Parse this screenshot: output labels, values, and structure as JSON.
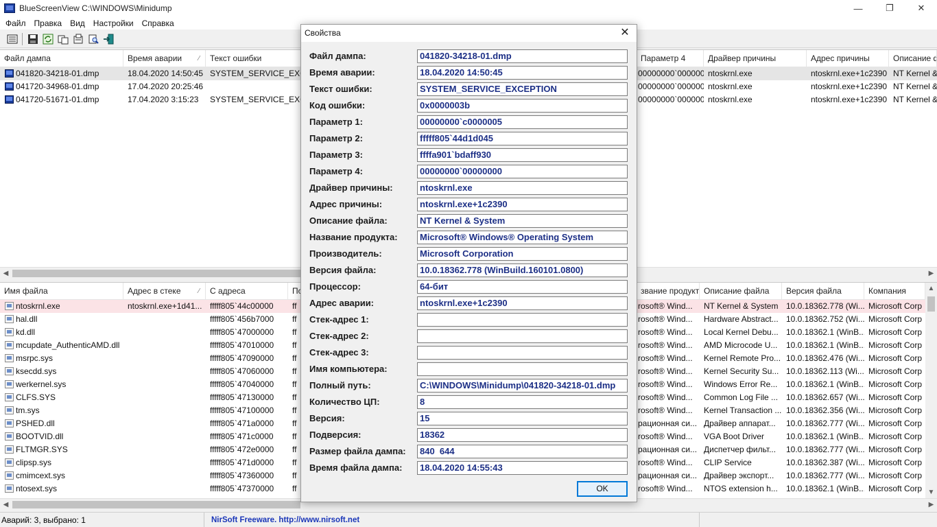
{
  "window": {
    "title": "BlueScreenView    C:\\WINDOWS\\Minidump",
    "minimize": "—",
    "restore": "❐",
    "close": "✕"
  },
  "menu": [
    "Файл",
    "Правка",
    "Вид",
    "Настройки",
    "Справка"
  ],
  "toolbar": {
    "icons": [
      "properties-icon",
      "save-icon",
      "refresh-icon",
      "copy-icon",
      "options-icon",
      "find-icon",
      "exit-icon"
    ]
  },
  "top_list": {
    "columns": [
      "Файл дампа",
      "Время аварии",
      "Текст ошибки",
      "Параметр 4",
      "Драйвер причины",
      "Адрес причины",
      "Описание ф"
    ],
    "sort_indicator": "⁄",
    "rows": [
      {
        "file": "041820-34218-01.dmp",
        "time": "18.04.2020 14:50:45",
        "text": "SYSTEM_SERVICE_EXCEPT",
        "p4": "00000000`000000...",
        "driver": "ntoskrnl.exe",
        "address": "ntoskrnl.exe+1c2390",
        "desc": "NT Kernel & S"
      },
      {
        "file": "041720-34968-01.dmp",
        "time": "17.04.2020 20:25:46",
        "text": "",
        "p4": "00000000`000000...",
        "driver": "ntoskrnl.exe",
        "address": "ntoskrnl.exe+1c2390",
        "desc": "NT Kernel & S"
      },
      {
        "file": "041720-51671-01.dmp",
        "time": "17.04.2020 3:15:23",
        "text": "SYSTEM_SERVICE_EXCEPT",
        "p4": "00000000`000000...",
        "driver": "ntoskrnl.exe",
        "address": "ntoskrnl.exe+1c2390",
        "desc": "NT Kernel & S"
      }
    ]
  },
  "bottom_list": {
    "columns": [
      "Имя файла",
      "Адрес в стеке",
      "С адреса",
      "По",
      "звание продукта",
      "Описание файла",
      "Версия файла",
      "Компания"
    ],
    "sort_indicator": "⁄",
    "rows": [
      {
        "name": "ntoskrnl.exe",
        "stack": "ntoskrnl.exe+1d41...",
        "from": "fffff805`44c00000",
        "to": "ff",
        "product": "rosoft® Wind...",
        "desc": "NT Kernel & System",
        "version": "10.0.18362.778 (Wi...",
        "company": "Microsoft Corp"
      },
      {
        "name": "hal.dll",
        "stack": "",
        "from": "fffff805`456b7000",
        "to": "ff",
        "product": "rosoft® Wind...",
        "desc": "Hardware Abstract...",
        "version": "10.0.18362.752 (Wi...",
        "company": "Microsoft Corp"
      },
      {
        "name": "kd.dll",
        "stack": "",
        "from": "fffff805`47000000",
        "to": "ff",
        "product": "rosoft® Wind...",
        "desc": "Local Kernel Debu...",
        "version": "10.0.18362.1 (WinB...",
        "company": "Microsoft Corp"
      },
      {
        "name": "mcupdate_AuthenticAMD.dll",
        "stack": "",
        "from": "fffff805`47010000",
        "to": "ff",
        "product": "rosoft® Wind...",
        "desc": "AMD Microcode U...",
        "version": "10.0.18362.1 (WinB...",
        "company": "Microsoft Corp"
      },
      {
        "name": "msrpc.sys",
        "stack": "",
        "from": "fffff805`47090000",
        "to": "ff",
        "product": "rosoft® Wind...",
        "desc": "Kernel Remote Pro...",
        "version": "10.0.18362.476 (Wi...",
        "company": "Microsoft Corp"
      },
      {
        "name": "ksecdd.sys",
        "stack": "",
        "from": "fffff805`47060000",
        "to": "ff",
        "product": "rosoft® Wind...",
        "desc": "Kernel Security Su...",
        "version": "10.0.18362.113 (Wi...",
        "company": "Microsoft Corp"
      },
      {
        "name": "werkernel.sys",
        "stack": "",
        "from": "fffff805`47040000",
        "to": "ff",
        "product": "rosoft® Wind...",
        "desc": "Windows Error Re...",
        "version": "10.0.18362.1 (WinB...",
        "company": "Microsoft Corp"
      },
      {
        "name": "CLFS.SYS",
        "stack": "",
        "from": "fffff805`47130000",
        "to": "ff",
        "product": "rosoft® Wind...",
        "desc": "Common Log File ...",
        "version": "10.0.18362.657 (Wi...",
        "company": "Microsoft Corp"
      },
      {
        "name": "tm.sys",
        "stack": "",
        "from": "fffff805`47100000",
        "to": "ff",
        "product": "rosoft® Wind...",
        "desc": "Kernel Transaction ...",
        "version": "10.0.18362.356 (Wi...",
        "company": "Microsoft Corp"
      },
      {
        "name": "PSHED.dll",
        "stack": "",
        "from": "fffff805`471a0000",
        "to": "ff",
        "product": "рационная си...",
        "desc": "Драйвер аппарат...",
        "version": "10.0.18362.777 (Wi...",
        "company": "Microsoft Corp"
      },
      {
        "name": "BOOTVID.dll",
        "stack": "",
        "from": "fffff805`471c0000",
        "to": "ff",
        "product": "rosoft® Wind...",
        "desc": "VGA Boot Driver",
        "version": "10.0.18362.1 (WinB...",
        "company": "Microsoft Corp"
      },
      {
        "name": "FLTMGR.SYS",
        "stack": "",
        "from": "fffff805`472e0000",
        "to": "ff",
        "product": "рационная си...",
        "desc": "Диспетчер фильт...",
        "version": "10.0.18362.777 (Wi...",
        "company": "Microsoft Corp"
      },
      {
        "name": "clipsp.sys",
        "stack": "",
        "from": "fffff805`471d0000",
        "to": "ff",
        "product": "rosoft® Wind...",
        "desc": "CLIP Service",
        "version": "10.0.18362.387 (Wi...",
        "company": "Microsoft Corp"
      },
      {
        "name": "cmimcext.sys",
        "stack": "",
        "from": "fffff805`47360000",
        "to": "ff",
        "product": "рационная си...",
        "desc": "Драйвер экспорт...",
        "version": "10.0.18362.777 (Wi...",
        "company": "Microsoft Corp"
      },
      {
        "name": "ntosext.sys",
        "stack": "",
        "from": "fffff805`47370000",
        "to": "ff",
        "product": "rosoft® Wind...",
        "desc": "NTOS extension h...",
        "version": "10.0.18362.1 (WinB...",
        "company": "Microsoft Corp"
      }
    ]
  },
  "dialog": {
    "title": "Свойства",
    "close": "✕",
    "ok": "OK",
    "fields": [
      {
        "label": "Файл дампа:",
        "value": "041820-34218-01.dmp"
      },
      {
        "label": "Время аварии:",
        "value": "18.04.2020 14:50:45"
      },
      {
        "label": "Текст ошибки:",
        "value": "SYSTEM_SERVICE_EXCEPTION"
      },
      {
        "label": "Код ошибки:",
        "value": "0x0000003b"
      },
      {
        "label": "Параметр 1:",
        "value": "00000000`c0000005"
      },
      {
        "label": "Параметр 2:",
        "value": "fffff805`44d1d045"
      },
      {
        "label": "Параметр 3:",
        "value": "ffffa901`bdaff930"
      },
      {
        "label": "Параметр 4:",
        "value": "00000000`00000000"
      },
      {
        "label": "Драйвер причины:",
        "value": "ntoskrnl.exe"
      },
      {
        "label": "Адрес причины:",
        "value": "ntoskrnl.exe+1c2390"
      },
      {
        "label": "Описание файла:",
        "value": "NT Kernel & System"
      },
      {
        "label": "Название продукта:",
        "value": "Microsoft® Windows® Operating System"
      },
      {
        "label": "Производитель:",
        "value": "Microsoft Corporation"
      },
      {
        "label": "Версия файла:",
        "value": "10.0.18362.778 (WinBuild.160101.0800)"
      },
      {
        "label": "Процессор:",
        "value": "64-бит"
      },
      {
        "label": "Адрес аварии:",
        "value": "ntoskrnl.exe+1c2390"
      },
      {
        "label": "Стек-адрес 1:",
        "value": ""
      },
      {
        "label": "Стек-адрес 2:",
        "value": ""
      },
      {
        "label": "Стек-адрес 3:",
        "value": ""
      },
      {
        "label": "Имя компьютера:",
        "value": ""
      },
      {
        "label": "Полный путь:",
        "value": "C:\\WINDOWS\\Minidump\\041820-34218-01.dmp"
      },
      {
        "label": "Количество ЦП:",
        "value": "8"
      },
      {
        "label": "Версия:",
        "value": "15"
      },
      {
        "label": "Подверсия:",
        "value": "18362"
      },
      {
        "label": "Размер файла дампа:",
        "value": "840  644"
      },
      {
        "label": "Время файла дампа:",
        "value": "18.04.2020 14:55:43"
      }
    ]
  },
  "status": {
    "count": "Аварий: 3, выбрано: 1",
    "link": "NirSoft Freeware.  http://www.nirsoft.net"
  },
  "scroll": {
    "left": "◀",
    "right": "▶",
    "up": "▲",
    "down": "▼"
  },
  "colors": {
    "field_text": "#1c2f86",
    "link": "#1a36b8",
    "selected_row": "#e5e5e5",
    "highlight_row": "#fbe3e6"
  }
}
